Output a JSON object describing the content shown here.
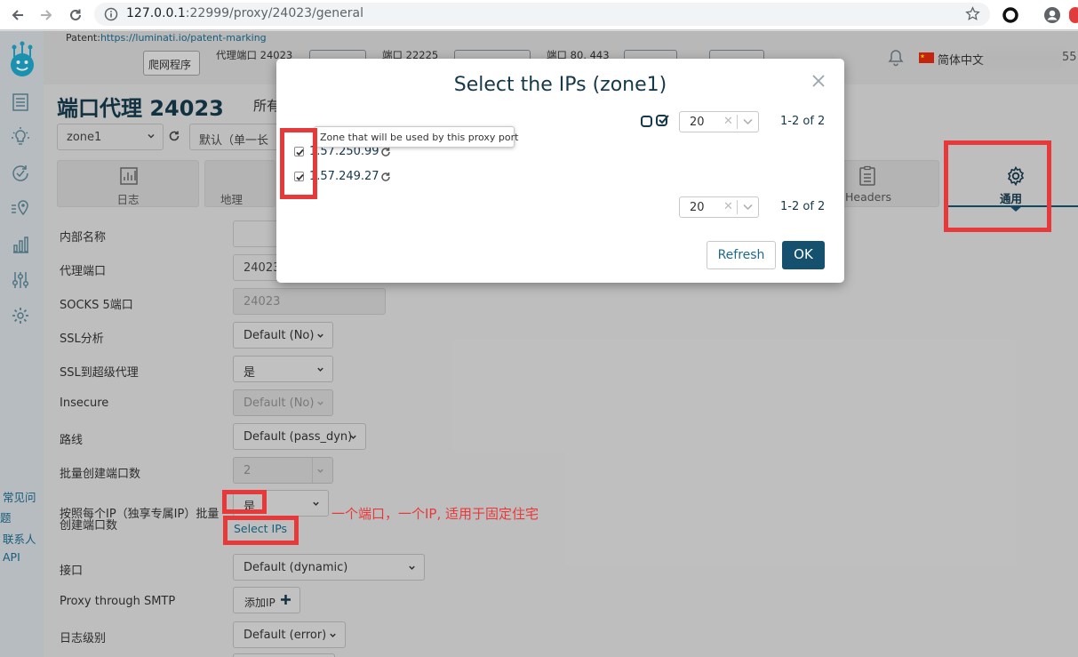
{
  "browser": {
    "url_host": "127.0.0.1",
    "url_rest": ":22999/proxy/24023/general"
  },
  "topbar": {
    "patent_label": "Patent:",
    "patent_link": "https://luminati.io/patent-marking",
    "crawler_button": "爬网程序",
    "proxy_port_label": "代理端口 24023",
    "port_22225": "端口 22225",
    "port_80_443": "端口 80, 443",
    "language": "简体中文",
    "trailing": "55"
  },
  "page": {
    "title": "端口代理 24023",
    "title_suffix": "所有",
    "zone_select": "zone1",
    "preset_select": "默认（单一长"
  },
  "tabs": [
    {
      "label": "日志"
    },
    {
      "label": "地理"
    },
    {
      "label": "Headers"
    },
    {
      "label": "通用"
    }
  ],
  "form": {
    "internal_name_label": "内部名称",
    "internal_name_value": "",
    "proxy_port_label": "代理端口",
    "proxy_port_value": "24023",
    "socks_label": "SOCKS 5端口",
    "socks_value": "24023",
    "ssl_analysis_label": "SSL分析",
    "ssl_analysis_value": "Default (No)",
    "ssl_super_label": "SSL到超级代理",
    "ssl_super_value": "是",
    "insecure_label": "Insecure",
    "insecure_value": "Default (No)",
    "route_label": "路线",
    "route_value": "Default (pass_dyn)",
    "batch_label": "批量创建端口数",
    "batch_value": "2",
    "per_ip_label_1": "按照每个IP（独享专属IP）批量",
    "per_ip_label_2": "创建端口数",
    "per_ip_value": "是",
    "select_ips_link": "Select IPs",
    "interface_label": "接口",
    "interface_value": "Default (dynamic)",
    "smtp_label": "Proxy through SMTP",
    "smtp_button": "添加IP",
    "log_level_label": "日志级别",
    "log_level_value": "Default (error)"
  },
  "sidebar_links": [
    "常见问",
    "题",
    "联系人",
    "API"
  ],
  "annotation": "一个端口，一个IP, 适用于固定住宅",
  "modal": {
    "title": "Select the IPs (zone1)",
    "page_size": "20",
    "page_range": "1-2 of 2",
    "tooltip": "Zone that will be used by this proxy port",
    "ips": [
      "1.57.250.99",
      "1.57.249.27"
    ],
    "refresh_button": "Refresh",
    "ok_button": "OK"
  },
  "colors": {
    "brand_dark": "#15384a",
    "link_blue": "#1c6a8e",
    "primary_button": "#15516e",
    "highlight_red": "#e8393a"
  }
}
